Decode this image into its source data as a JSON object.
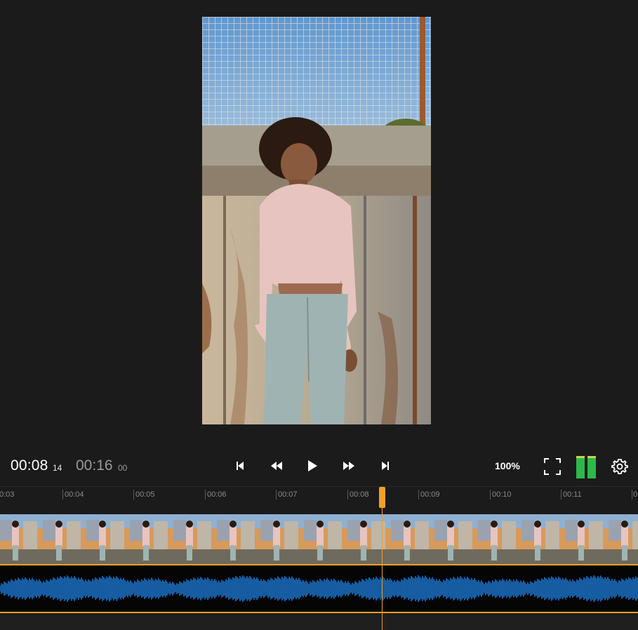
{
  "preview": {
    "content": "video-frame"
  },
  "transport": {
    "current_time": "00:08",
    "current_frames": "14",
    "total_time": "00:16",
    "total_frames": "00",
    "zoom": "100%"
  },
  "icons": {
    "skip_start": "skip-to-start-icon",
    "rewind": "rewind-icon",
    "play": "play-icon",
    "fast_forward": "fast-forward-icon",
    "skip_end": "skip-to-end-icon",
    "fullscreen": "fullscreen-icon",
    "settings": "gear-icon"
  },
  "timeline": {
    "ruler": [
      "0:03",
      "00:04",
      "00:05",
      "00:06",
      "00:07",
      "00:08",
      "00:09",
      "00:10",
      "00:11",
      "0"
    ],
    "playhead_time": "00:08"
  },
  "colors": {
    "accent": "#f4a024",
    "audio_wave": "#1a73c9",
    "meter": "#2db84a",
    "background": "#1b1b1b"
  }
}
